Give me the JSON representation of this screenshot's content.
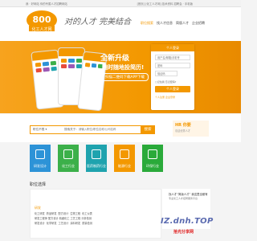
{
  "topbar": {
    "left": "我 · 好网站 你的专属人才招聘网站",
    "right": "[首页] [化工人才网] 技术资料 招聘会 · 手机版"
  },
  "header": {
    "logo_text": "800",
    "logo_sub": "化工人才网",
    "slogan": "对的人才 完美结合",
    "nav": [
      "职位搜索",
      "找人才信息",
      "简版人才",
      "企业招聘"
    ]
  },
  "banner": {
    "title": "全新升级",
    "subtitle": "随时随地投简历!",
    "button": "扫描二维码下载APP下载"
  },
  "login": {
    "tab": "个人登录",
    "username_placeholder": "用户名/邮箱/手机号",
    "password_placeholder": "密码",
    "code_placeholder": "验证码",
    "links": "□记住我  忘记密码?",
    "button": "个人登录",
    "links2": "个人注册   企业登录"
  },
  "search": {
    "type_label": "职位不限 ▾",
    "scope_label": "搜索关于:",
    "placeholder": "请输入职位/职位名称/公司名称",
    "button": "搜索"
  },
  "hr_ad": {
    "title": "HR 你要",
    "sub": "欢迎优秀人才"
  },
  "categories": [
    {
      "label": "研发设计",
      "color": "#2d93d7"
    },
    {
      "label": "化工行业",
      "color": "#3cb04a"
    },
    {
      "label": "医药制药行业",
      "color": "#1fa3ae"
    },
    {
      "label": "能源行业",
      "color": "#f39800"
    },
    {
      "label": "环保行业",
      "color": "#2aaa3a"
    }
  ],
  "jobs_section": {
    "title": "职位选择",
    "head": "研发",
    "rows": "化工研发  药品研发  配方设计  生物工程  化工仪表\n研发工程师 配方设计 精细化工 工艺工程 分析检测\n研发设计  化学研发  工艺设计  涂料研发  质量检测"
  },
  "right_ad": {
    "line1": "找人才“简版人才”  我这里全都有",
    "line2": "专业化工人才招聘服务平台"
  },
  "watermark": {
    "text": "IZ.dnh.TOP",
    "sub": "拾光分享网"
  }
}
